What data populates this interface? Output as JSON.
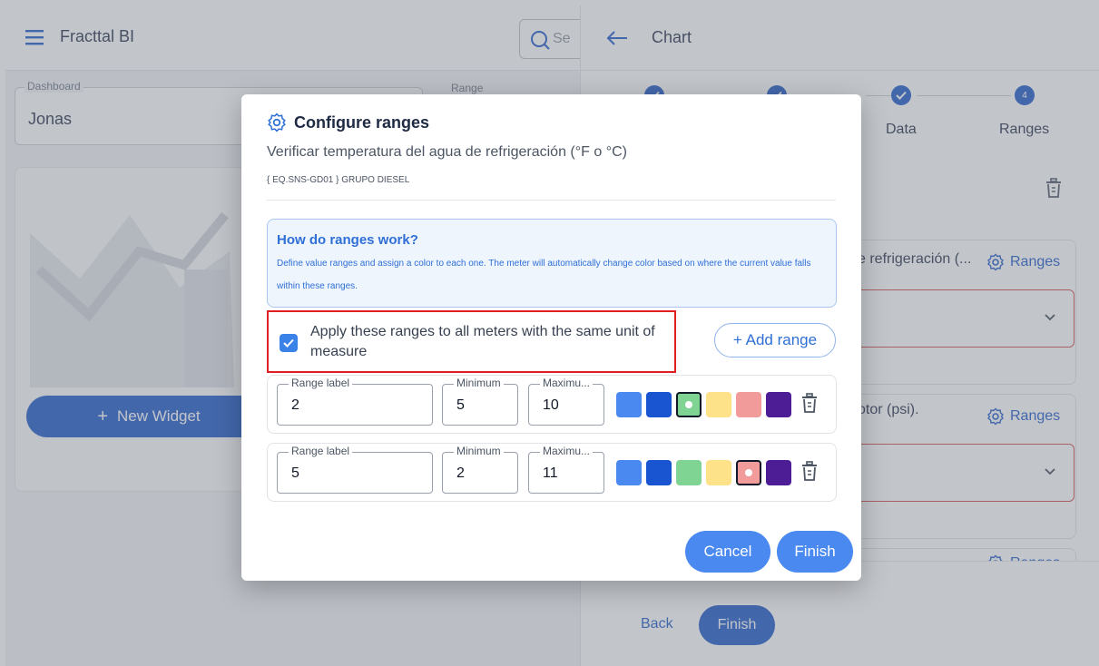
{
  "left": {
    "app_title": "Fracttal BI",
    "search_placeholder": "Se",
    "dashboard_label": "Dashboard",
    "dashboard_value": "Jonas",
    "range_label": "Range",
    "new_widget_label": "New Widget"
  },
  "drawer": {
    "title": "Chart",
    "steps": [
      {
        "label": "",
        "status": "done"
      },
      {
        "label": "",
        "status": "done"
      },
      {
        "label": "Data",
        "status": "done"
      },
      {
        "label": "Ranges",
        "number": "4",
        "status": "current"
      }
    ],
    "meters": [
      {
        "title": "e refrigeración (...",
        "ranges_label": "Ranges"
      },
      {
        "title": "otor (psi).",
        "ranges_label": "Ranges"
      },
      {
        "title": "",
        "ranges_label": "Ranges"
      }
    ],
    "back_label": "Back",
    "finish_label": "Finish"
  },
  "modal": {
    "title": "Configure ranges",
    "subtitle": "Verificar temperatura del agua de refrigeración (°F o °C)",
    "equipment": "{ EQ.SNS-GD01 } GRUPO DIESEL",
    "info_title": "How do ranges work?",
    "info_text": "Define value ranges and assign a color to each one. The meter will automatically change color based on where the current value falls within these ranges.",
    "apply_label": "Apply these ranges to all meters with the same unit of measure",
    "apply_checked": true,
    "add_range_label": "+ Add range",
    "field_labels": {
      "label": "Range label",
      "minimum": "Minimum",
      "maximum": "Maximu..."
    },
    "palette": [
      "#4a8af0",
      "#1954d1",
      "#7fd494",
      "#fde28a",
      "#f19b9b",
      "#4c1d95"
    ],
    "ranges": [
      {
        "label": "2",
        "minimum": "5",
        "maximum": "10",
        "selected_color": 2
      },
      {
        "label": "5",
        "minimum": "2",
        "maximum": "11",
        "selected_color": 4
      }
    ],
    "cancel_label": "Cancel",
    "finish_label": "Finish"
  }
}
